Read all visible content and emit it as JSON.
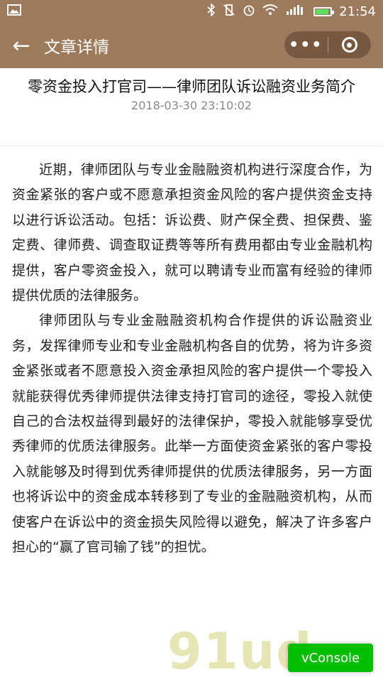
{
  "status_bar": {
    "time": "21:54",
    "icons": [
      "image-icon",
      "bluetooth-icon",
      "vibrate-off-icon",
      "alarm-icon",
      "wifi-icon",
      "signal-icon",
      "battery-icon"
    ]
  },
  "header": {
    "title": "文章详情",
    "back_icon": "←",
    "more_icon": "•••",
    "background": "#9e7a5c"
  },
  "article": {
    "title": "零资金投入打官司——律师团队诉讼融资业务简介",
    "date": "2018-03-30 23:10:02",
    "paragraphs": [
      "近期，律师团队与专业金融融资机构进行深度合作，为资金紧张的客户或不愿意承担资金风险的客户提供资金支持以进行诉讼活动。包括：诉讼费、财产保全费、担保费、鉴定费、律师费、调查取证费等等所有费用都由专业金融机构提供，客户零资金投入，就可以聘请专业而富有经验的律师提供优质的法律服务。",
      "律师团队与专业金融融资机构合作提供的诉讼融资业务，发挥律师专业和专业金融机构各自的优势，将为许多资金紧张或者不愿意投入资金承担风险的客户提供一个零投入就能获得优秀律师提供法律支持打官司的途径，零投入就使自己的合法权益得到最好的法律保护，零投入就能够享受优秀律师的优质法律服务。此举一方面使资金紧张的客户零投入就能够及时得到优秀律师提供的优质法律服务，另一方面也将诉讼中的资金成本转移到了专业的金融融资机构，从而使客户在诉讼中的资金损失风险得以避免，解决了许多客户担心的“赢了官司输了钱”的担忧。"
    ]
  },
  "watermark": "91ud",
  "vconsole_label": "vConsole"
}
